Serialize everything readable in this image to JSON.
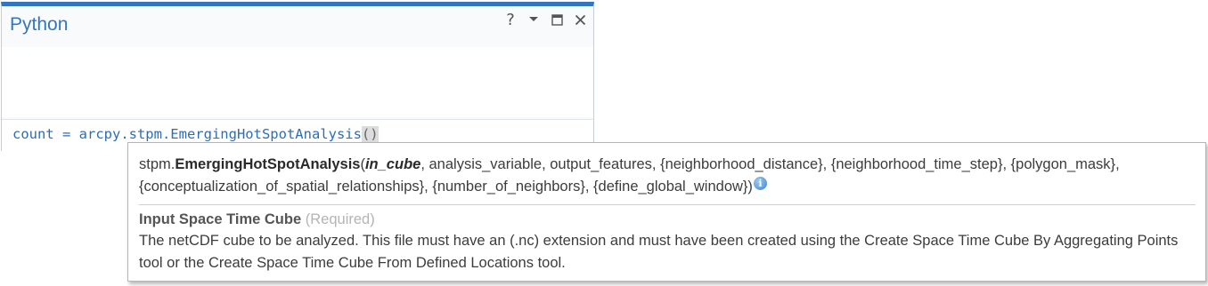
{
  "pane": {
    "title": "Python",
    "controls": {
      "help": "?",
      "menu_icon": "chevron-down-icon",
      "maximize_icon": "maximize-icon",
      "close_icon": "close-icon"
    },
    "input": {
      "code_prefix": "count = arcpy.stpm.EmergingHotSpotAnalysis",
      "code_parens": "()"
    }
  },
  "tooltip": {
    "signature": {
      "module": "stpm.",
      "function": "EmergingHotSpotAnalysis",
      "open_paren": "(",
      "current_param": "in_cube",
      "rest_params": ", analysis_variable, output_features, {neighborhood_distance}, {neighborhood_time_step}, {polygon_mask}, {conceptualization_of_spatial_relationships}, {number_of_neighbors}, {define_global_window})",
      "info_icon": "info-icon"
    },
    "parameter": {
      "name": "Input Space Time Cube",
      "requirement": "(Required)",
      "description": "The netCDF cube to be analyzed. This file must have an (.nc) extension and must have been created using the Create Space Time Cube By Aggregating Points tool or the Create Space Time Cube From Defined Locations tool."
    }
  },
  "colors": {
    "accent": "#3376c0",
    "code": "#2f6db3",
    "info_icon": "#3d86cf"
  }
}
